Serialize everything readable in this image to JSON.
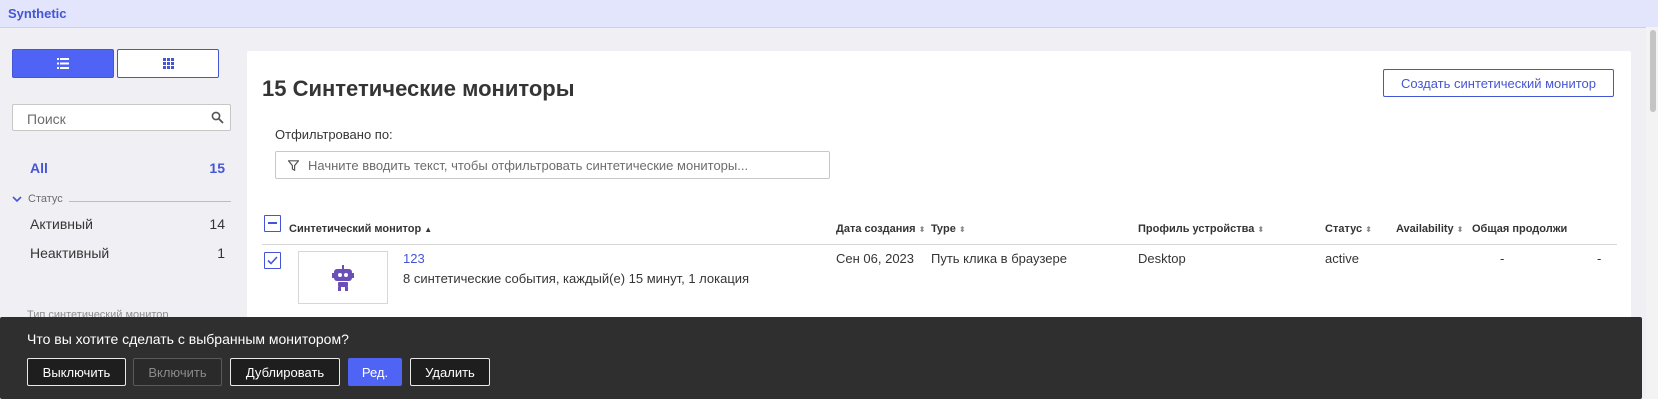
{
  "app": {
    "title": "Synthetic"
  },
  "sidebar": {
    "search_placeholder": "Поиск",
    "all": {
      "label": "All",
      "count": "15"
    },
    "status_section": "Статус",
    "items": [
      {
        "label": "Активный",
        "count": "14"
      },
      {
        "label": "Неактивный",
        "count": "1"
      }
    ],
    "next_section": "Тип синтетический монитор"
  },
  "main": {
    "title": "15 Синтетические мониторы",
    "create_button": "Создать синтетический монитор",
    "filter_label": "Отфильтровано по:",
    "filter_placeholder": "Начните вводить текст, чтобы отфильтровать синтетические мониторы...",
    "columns": {
      "monitor": "Синтетический монитор",
      "created": "Дата создания",
      "type": "Type",
      "device": "Профиль устройства",
      "status": "Статус",
      "availability": "Availability",
      "duration": "Общая продолжи"
    },
    "rows": [
      {
        "name": "123",
        "description": "8 синтетические события, каждый(е) 15 минут, 1 локация",
        "created": "Сен 06, 2023",
        "type": "Путь клика в браузере",
        "device": "Desktop",
        "status": "active",
        "availability": "-",
        "duration": "-"
      }
    ]
  },
  "action_bar": {
    "title": "Что вы хотите сделать с выбранным монитором?",
    "disable": "Выключить",
    "enable": "Включить",
    "duplicate": "Дублировать",
    "edit": "Ред.",
    "delete": "Удалить"
  },
  "colors": {
    "accent": "#4f63f5",
    "brand": "#4556d4",
    "robot": "#6a4fb8"
  }
}
